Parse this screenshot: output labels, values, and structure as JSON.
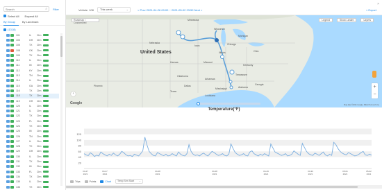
{
  "left_panel": {
    "search_placeholder": "Search",
    "filter_label": "Filter",
    "select_all": "Select All",
    "expand_all": "Expand All",
    "tabs": [
      "By Group",
      "By Landmark"
    ],
    "group_name": "(1318)",
    "rows": [
      {
        "id": "101",
        "state": "IL",
        "ch": "Chn",
        "color": "#3fb05b"
      },
      {
        "id": "103",
        "state": "OH",
        "ch": "Chn",
        "color": "#3fb05b"
      },
      {
        "id": "105",
        "state": "TX",
        "ch": "Chn",
        "color": "#3fb05b"
      },
      {
        "id": "108",
        "state": "OK",
        "ch": "Chn",
        "color": "#e05a3a"
      },
      {
        "id": "109",
        "state": "TX",
        "ch": "Chn",
        "color": "#3fb05b"
      },
      {
        "id": "110",
        "state": "IL",
        "ch": "Chn",
        "color": "#3fb05b"
      },
      {
        "id": "111",
        "state": "IN",
        "ch": "Chn",
        "color": "#3fb05b"
      },
      {
        "id": "112",
        "state": "KY",
        "ch": "Chn",
        "color": "#3fb05b"
      },
      {
        "id": "113",
        "state": "TN",
        "ch": "Chn",
        "color": "#3fb05b"
      },
      {
        "id": "114",
        "state": "IL",
        "ch": "Chn",
        "color": "#3fb05b"
      },
      {
        "id": "115",
        "state": "GA",
        "ch": "Chn",
        "color": "#3fb05b"
      },
      {
        "id": "116",
        "state": "TX",
        "ch": "Chn",
        "color": "#3fb05b"
      },
      {
        "id": "118",
        "state": "TX",
        "ch": "Chn",
        "color": "#3fb05b"
      },
      {
        "id": "119",
        "state": "OH",
        "ch": "Chn",
        "color": "#3fb05b"
      },
      {
        "id": "120",
        "state": "IL",
        "ch": "Chn",
        "color": "#3fb05b"
      },
      {
        "id": "121",
        "state": "IL",
        "ch": "Chn",
        "color": "#3fb05b"
      },
      {
        "id": "122",
        "state": "TX",
        "ch": "Chn",
        "color": "#3fb05b"
      },
      {
        "id": "123",
        "state": "FL",
        "ch": "Chn",
        "color": "#3fb05b"
      },
      {
        "id": "124",
        "state": "TX",
        "ch": "Chn",
        "color": "#3fb05b"
      },
      {
        "id": "125",
        "state": "IN",
        "ch": "Chn",
        "color": "#3fb05b"
      },
      {
        "id": "126",
        "state": "TN",
        "ch": "Chn",
        "color": "#3fb05b"
      },
      {
        "id": "127",
        "state": "IL",
        "ch": "Chn",
        "color": "#3fb05b"
      },
      {
        "id": "128",
        "state": "TX",
        "ch": "Chn",
        "color": "#3fb05b"
      },
      {
        "id": "129",
        "state": "OH",
        "ch": "Chn",
        "color": "#3fb05b"
      },
      {
        "id": "130",
        "state": "IL",
        "ch": "Chn",
        "color": "#3fb05b"
      },
      {
        "id": "131",
        "state": "TX",
        "ch": "Chn",
        "color": "#3fb05b"
      },
      {
        "id": "132",
        "state": "IN",
        "ch": "Chn",
        "color": "#3fb05b"
      },
      {
        "id": "133",
        "state": "FL",
        "ch": "Chn",
        "color": "#3fb05b"
      },
      {
        "id": "134",
        "state": "TX",
        "ch": "Chn",
        "color": "#3fb05b"
      },
      {
        "id": "135",
        "state": "IL",
        "ch": "Chn",
        "color": "#3fb05b"
      },
      {
        "id": "136",
        "state": "TX",
        "ch": "Chn",
        "color": "#3fb05b"
      }
    ]
  },
  "topbar": {
    "vehicle_label": "Vehicle: 108",
    "period": "This week",
    "range": "< Prev  2021-04-26 00:00 ~ 2021-05-02 23:59  Next >",
    "export": "< Export",
    "close": "×"
  },
  "map": {
    "type_select": "Roadmap / Customized",
    "controls": [
      "Legend",
      "Show Landm",
      "Layers"
    ],
    "country_label": "United States",
    "labels": [
      {
        "text": "Minnesota"
      },
      {
        "text": "Wisconsin"
      },
      {
        "text": "Michigan"
      },
      {
        "text": "Iowa"
      },
      {
        "text": "Illinois"
      },
      {
        "text": "Ohio"
      },
      {
        "text": "Kansas"
      },
      {
        "text": "Missouri"
      },
      {
        "text": "Kentucky"
      },
      {
        "text": "Oklahoma"
      },
      {
        "text": "Arkansas"
      },
      {
        "text": "Tennessee"
      },
      {
        "text": "Texas"
      },
      {
        "text": "Mississippi"
      },
      {
        "text": "Alabama"
      },
      {
        "text": "Georgia"
      },
      {
        "text": "Chicago"
      },
      {
        "text": "Dallas"
      },
      {
        "text": "Louisiana"
      },
      {
        "text": "Phoenix"
      },
      {
        "text": "Nebraska"
      }
    ],
    "google": "Google",
    "attribution": "Map data ©2021 Google, INEGI  Terms of Use"
  },
  "chart": {
    "title": "Temperature(°F)",
    "bottom": {
      "trips": "Trips",
      "points": "Points",
      "chart": "Chart",
      "select": "Temp Sen Start"
    }
  },
  "chart_data": {
    "type": "line",
    "title": "Temperature(°F)",
    "ylim": [
      0,
      180
    ],
    "yticks": [
      20,
      40,
      60,
      80,
      100,
      120
    ],
    "xticks": [
      "04-27\n2021",
      "04-27\n2021",
      "04-28\n2021",
      "04-28\n2021",
      "04-29\n2021",
      "04-30\n2021",
      "05-01\n2021",
      "05-02\n2021"
    ],
    "series": [
      {
        "values": [
          52,
          48,
          45,
          55,
          50,
          42,
          47,
          44,
          58,
          52,
          48,
          44,
          50,
          46,
          54,
          48,
          44,
          50,
          60,
          55,
          48,
          44,
          46,
          42,
          50,
          47,
          44,
          52,
          62,
          110,
          82,
          60,
          52,
          46,
          44,
          56,
          52,
          48,
          45,
          50,
          44,
          46,
          52,
          48,
          44,
          58,
          50,
          46,
          44,
          52,
          84,
          60,
          50,
          46,
          48,
          44,
          50,
          54,
          48,
          44,
          52,
          60,
          56,
          50,
          46,
          48,
          52,
          46,
          44,
          50,
          86,
          70,
          56,
          50,
          46,
          48,
          52,
          46,
          44,
          58,
          62,
          52,
          48,
          44,
          50,
          46,
          52,
          48,
          44,
          86,
          72,
          58,
          54,
          50,
          46,
          48,
          52,
          44,
          46,
          50,
          62,
          56,
          50,
          46,
          88,
          74,
          60,
          52,
          48,
          46,
          54,
          50,
          46,
          52,
          58,
          48,
          44,
          50,
          46,
          92,
          84,
          70,
          60,
          54,
          50,
          48,
          56,
          52,
          48,
          44,
          46,
          50,
          56,
          60,
          48,
          46,
          50,
          47
        ]
      }
    ]
  }
}
